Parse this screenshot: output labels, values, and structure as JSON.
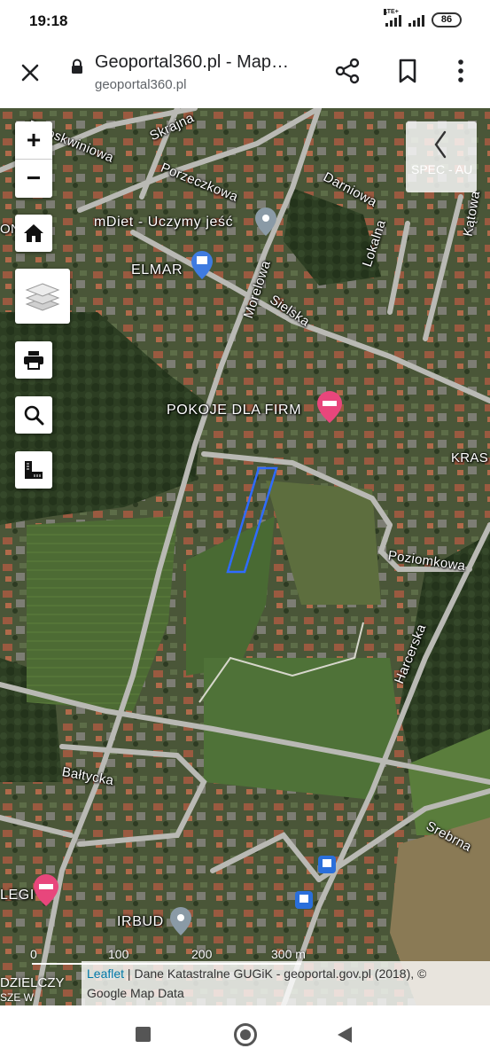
{
  "status_bar": {
    "time": "19:18",
    "network": "LTE+",
    "battery": "86"
  },
  "browser": {
    "page_title": "Geoportal360.pl - Map…",
    "url": "geoportal360.pl",
    "icons": [
      "close-icon",
      "lock-icon",
      "share-icon",
      "bookmark-icon",
      "more-icon"
    ]
  },
  "map_controls": {
    "zoom_in": "+",
    "zoom_out": "−",
    "side_panel_ghost_text": "SPEC - AU",
    "icons": [
      "home-icon",
      "layers-icon",
      "print-icon",
      "search-icon",
      "measure-icon",
      "chevron-left-icon"
    ]
  },
  "map": {
    "streets": {
      "brzoskwiniowa": "Brzoskwiniowa",
      "skrajna": "Skrajna",
      "porzeczkowa": "Porzeczkowa",
      "darniowa": "Darniowa",
      "katowa": "Kątowa",
      "lokalna": "Lokalna",
      "morelowa": "Morelowa",
      "sielska": "Sielska",
      "krasna": "KRAS",
      "poziomkowa": "Poziomkowa",
      "harcerska": "Harcerska",
      "baltycka": "Bałtycka",
      "srebrna": "Srebrna",
      "edge_on": "ON"
    },
    "pois": {
      "mdiet": "mDiet - Uczymy jeść",
      "elmar": "ELMAR",
      "pokoje": "POKOJE DLA FIRM",
      "irbud": "IRBUD",
      "legi": "LEGI",
      "dzielczy": "DZIELCZY",
      "dzielczy_sub": "SZE  W"
    },
    "scale": {
      "label_0": "0",
      "label_100": "100",
      "label_200": "200",
      "label_300": "300 m"
    },
    "attribution": {
      "leaflet": "Leaflet",
      "text": " | Dane Katastralne GUGiK - geoportal.gov.pl (2018), ©",
      "text2": "Google Map Data"
    },
    "colors": {
      "parcel_outline": "#2f6bff",
      "poi_pink": "#e8467c",
      "poi_blue": "#3f7be0",
      "poi_gray": "#8a9aa6",
      "bus_stop": "#2a6fdb"
    }
  },
  "navbar": {
    "icons": [
      "recent-apps-icon",
      "home-button-icon",
      "back-icon"
    ]
  }
}
